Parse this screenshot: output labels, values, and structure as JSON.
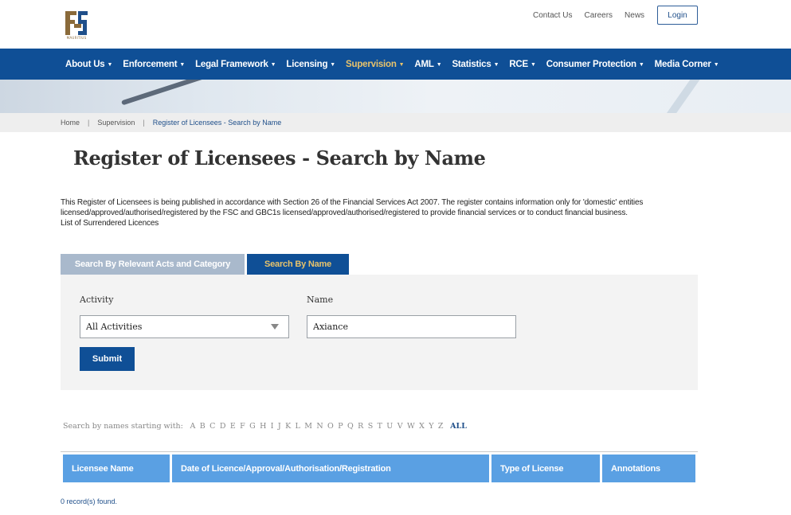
{
  "logo": {
    "text": "MAURITIUS"
  },
  "header": {
    "links": [
      "Contact Us",
      "Careers",
      "News"
    ],
    "login_label": "Login"
  },
  "nav": {
    "items": [
      {
        "label": "About Us",
        "active": false
      },
      {
        "label": "Enforcement",
        "active": false
      },
      {
        "label": "Legal Framework",
        "active": false
      },
      {
        "label": "Licensing",
        "active": false
      },
      {
        "label": "Supervision",
        "active": true
      },
      {
        "label": "AML",
        "active": false
      },
      {
        "label": "Statistics",
        "active": false
      },
      {
        "label": "RCE",
        "active": false
      },
      {
        "label": "Consumer Protection",
        "active": false
      },
      {
        "label": "Media Corner",
        "active": false
      }
    ],
    "active_color": "#e8c36b",
    "bar_color": "#0f4f96"
  },
  "breadcrumb": {
    "items": [
      "Home",
      "Supervision",
      "Register of Licensees - Search by Name"
    ],
    "separator": "|"
  },
  "page": {
    "title": "Register of Licensees - Search by Name",
    "intro_line1": "This Register of Licensees is being published in accordance with Section 26 of the Financial Services Act 2007. The register contains information only for 'domestic' entities",
    "intro_line2": "licensed/approved/authorised/registered by the FSC and GBC1s licensed/approved/authorised/registered to provide financial services or to conduct financial business.",
    "intro_line3": "List of Surrendered Licences"
  },
  "tabs": [
    {
      "label": "Search By Relevant Acts and Category",
      "active": false
    },
    {
      "label": "Search By Name",
      "active": true
    }
  ],
  "form": {
    "activity_label": "Activity",
    "activity_value": "All Activities",
    "name_label": "Name",
    "name_value": "Axiance",
    "submit_label": "Submit"
  },
  "alphabet": {
    "lead": "Search by names starting with:",
    "letters": [
      "A",
      "B",
      "C",
      "D",
      "E",
      "F",
      "G",
      "H",
      "I",
      "J",
      "K",
      "L",
      "M",
      "N",
      "O",
      "P",
      "Q",
      "R",
      "S",
      "T",
      "U",
      "V",
      "W",
      "X",
      "Y",
      "Z"
    ],
    "all_label": "ALL"
  },
  "table": {
    "columns": [
      "Licensee Name",
      "Date of Licence/Approval/Authorisation/Registration",
      "Type of License",
      "Annotations"
    ],
    "header_color": "#5aa0e3",
    "records_text": "0 record(s) found."
  }
}
